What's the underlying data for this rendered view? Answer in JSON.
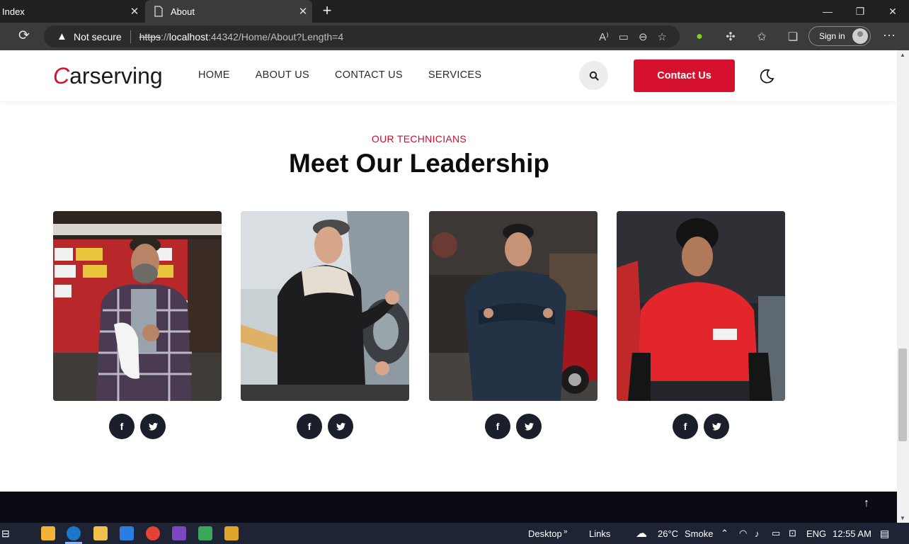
{
  "browser": {
    "tabs": [
      {
        "title": "Index"
      },
      {
        "title": "About"
      }
    ],
    "security_label": "Not secure",
    "url": {
      "scheme": "https",
      "sep": "://",
      "host": "localhost",
      "rest": ":44342/Home/About?Length=4"
    },
    "sign_in_label": "Sign in"
  },
  "site": {
    "logo_initial": "C",
    "logo_rest": "arserving",
    "nav": [
      "HOME",
      "ABOUT US",
      "CONTACT US",
      "SERVICES"
    ],
    "contact_button": "Contact Us",
    "accent_color": "#d5112e"
  },
  "section": {
    "eyebrow": "OUR TECHNICIANS",
    "title": "Meet Our Leadership"
  },
  "team": [
    {
      "photo": "bearded mechanic in plaid shirt in front of license-plate wall",
      "socials": [
        "f",
        "t"
      ]
    },
    {
      "photo": "mechanic with cap working on wheel",
      "socials": [
        "f",
        "t"
      ]
    },
    {
      "photo": "mechanic in navy coveralls, arms crossed, garage",
      "socials": [
        "f",
        "t"
      ]
    },
    {
      "photo": "young mechanic in red t-shirt and black beanie",
      "socials": [
        "f",
        "t"
      ]
    }
  ],
  "taskbar": {
    "desktop_label": "Desktop",
    "links_label": "Links",
    "weather_temp": "26°C",
    "weather_desc": "Smoke",
    "language": "ENG",
    "time": "12:55 AM"
  }
}
